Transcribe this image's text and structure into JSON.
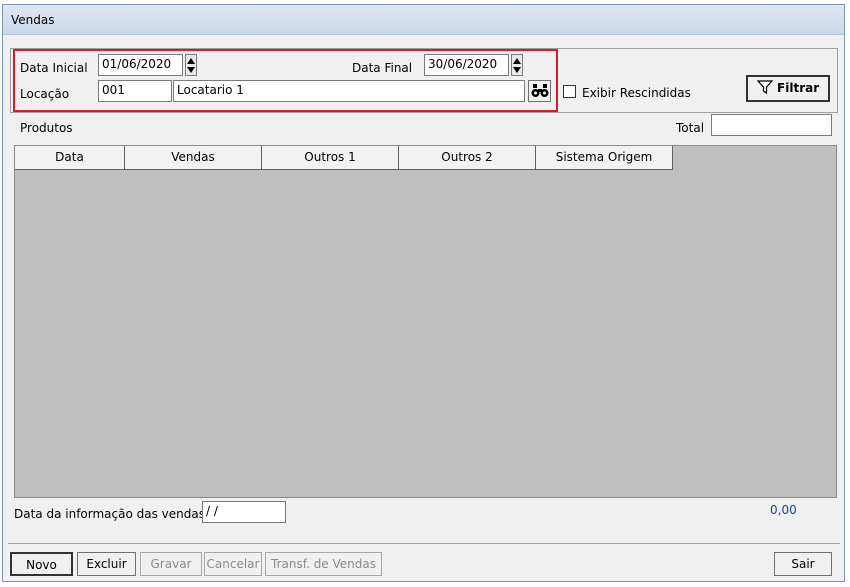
{
  "window": {
    "title": "Vendas"
  },
  "filters": {
    "data_inicial_label": "Data Inicial",
    "data_inicial_value": "01/06/2020",
    "data_final_label": "Data Final",
    "data_final_value": "30/06/2020",
    "locacao_label": "Locação",
    "locacao_code": "001",
    "locacao_name": "Locatario 1",
    "exibir_rescindidas_label": "Exibir Rescindidas",
    "exibir_rescindidas_checked": false,
    "filtrar_label": "Filtrar"
  },
  "produtos": {
    "label": "Produtos",
    "total_label": "Total",
    "total_value": ""
  },
  "grid": {
    "columns": [
      "Data",
      "Vendas",
      "Outros 1",
      "Outros 2",
      "Sistema Origem"
    ],
    "rows": []
  },
  "footer": {
    "data_info_label": "Data da informação das vendas",
    "data_info_value": " /  /",
    "sum_value": "0,00"
  },
  "toolbar": {
    "novo": "Novo",
    "excluir": "Excluir",
    "gravar": "Gravar",
    "cancelar": "Cancelar",
    "transf": "Transf. de Vendas",
    "sair": "Sair"
  },
  "colors": {
    "highlight_border": "#d0202a",
    "grid_background": "#bfbfbf",
    "sum_value": "#1f3f9f"
  },
  "icons": [
    "spin-up-down-icon",
    "binoculars-icon",
    "funnel-icon"
  ]
}
